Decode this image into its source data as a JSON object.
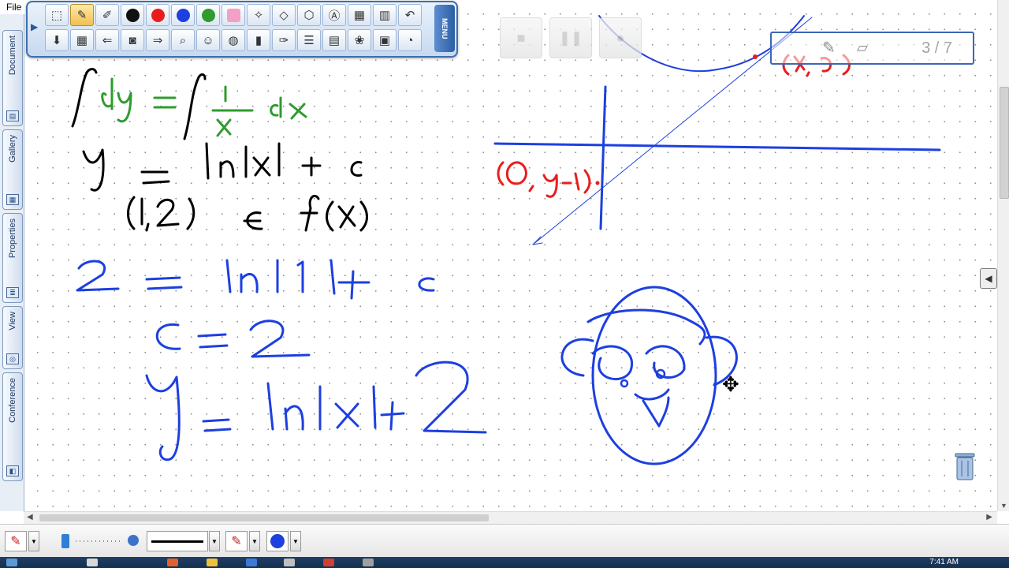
{
  "menu": {
    "file_label": "File"
  },
  "side_tabs": [
    {
      "label": "Document",
      "icon": "document-icon"
    },
    {
      "label": "Gallery",
      "icon": "gallery-icon"
    },
    {
      "label": "Properties",
      "icon": "properties-icon"
    },
    {
      "label": "View",
      "icon": "view-icon"
    },
    {
      "label": "Conference",
      "icon": "conference-icon"
    }
  ],
  "toolbar": {
    "menu_label": "MENU",
    "row1": [
      "select-tool-icon",
      "pen-tool-icon",
      "highlighter-tool-icon",
      "black-color",
      "red-color",
      "blue-color",
      "green-color",
      "pink-color",
      "wand-icon",
      "eraser-icon",
      "shapes-icon",
      "text-icon",
      "calculator-icon",
      "chart-icon",
      "undo-icon"
    ],
    "row2": [
      "download-icon",
      "grid-icon",
      "back-icon",
      "camera-icon",
      "forward-icon",
      "search-icon",
      "user-icon",
      "globe-icon",
      "door-icon",
      "paint-icon",
      "list-icon",
      "book-icon",
      "grape-icon",
      "photo-icon",
      "timer-icon"
    ],
    "colors": {
      "black": "#111111",
      "red": "#e81e1e",
      "blue": "#1d3fe0",
      "green": "#2e9c2e",
      "pink": "#f2a0c8"
    }
  },
  "page_indicator": {
    "text": "3 / 7"
  },
  "bottom_bar": {
    "pen_color": "#1d3fe0",
    "line_style": "solid"
  },
  "taskbar": {
    "clock": "7:41 AM"
  }
}
